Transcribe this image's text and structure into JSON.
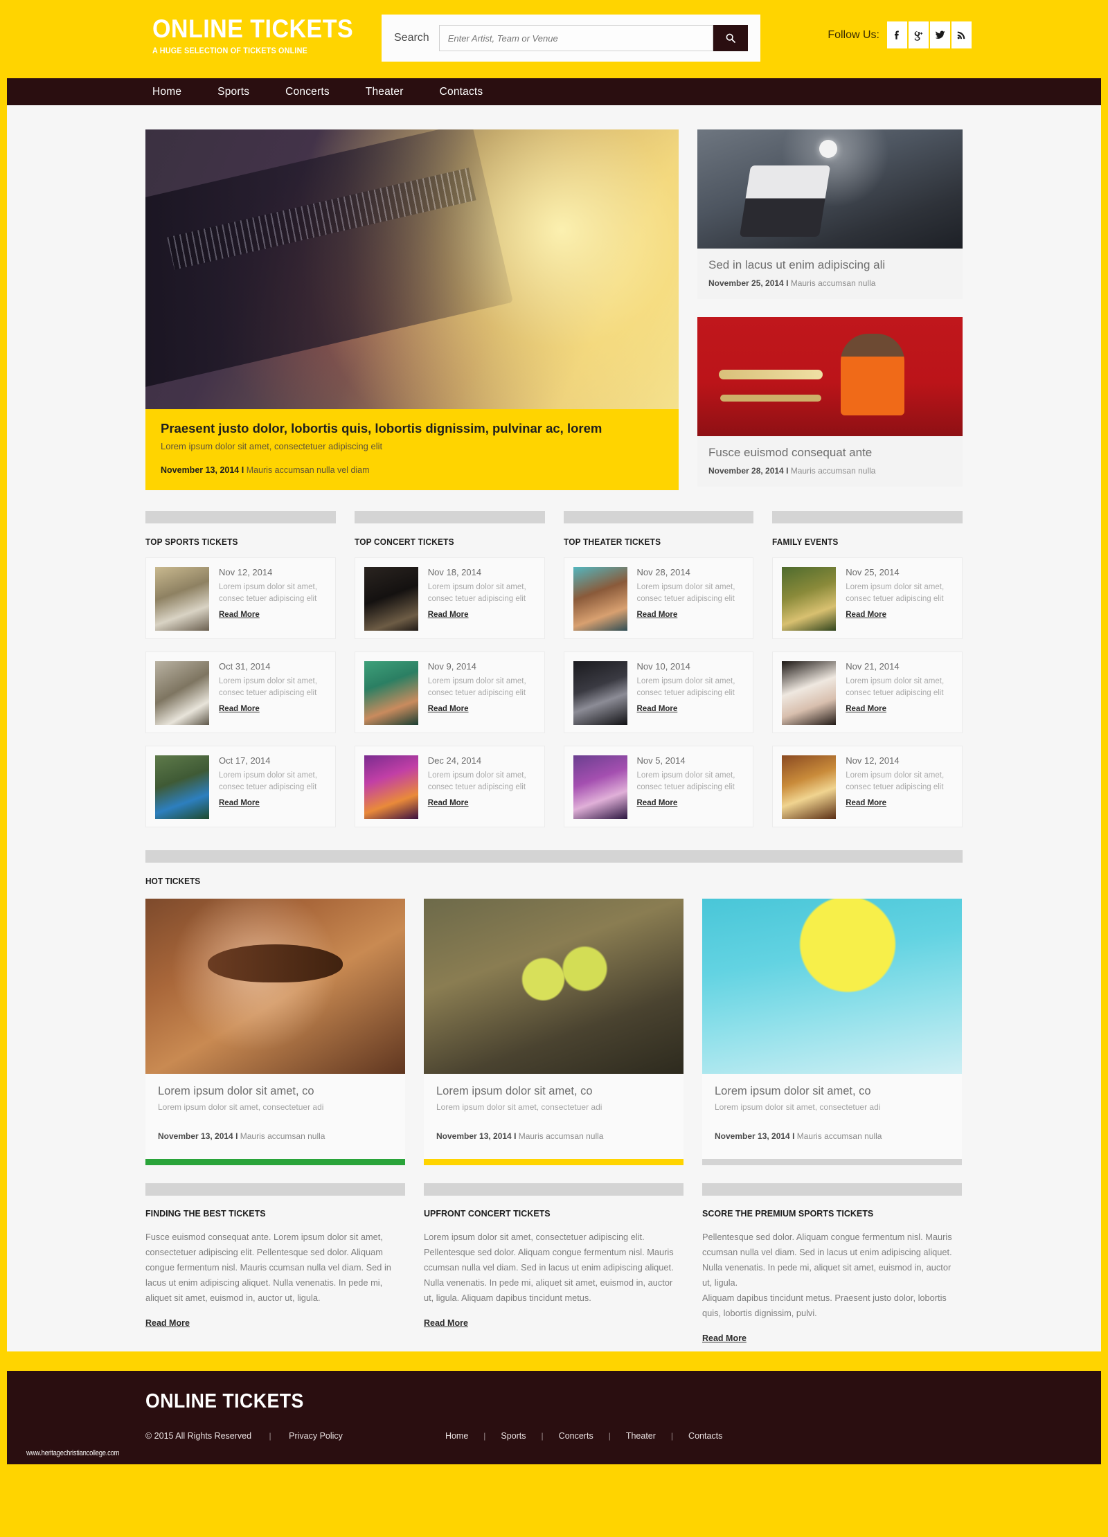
{
  "header": {
    "brand_title": "ONLINE TICKETS",
    "brand_sub": "A HUGE SELECTION OF TICKETS ONLINE",
    "search_label": "Search",
    "search_value": "",
    "search_placeholder": "Enter Artist, Team or Venue",
    "search_icon": "search-icon",
    "follow_label": "Follow Us:",
    "social": [
      {
        "name": "facebook-icon",
        "label": "f"
      },
      {
        "name": "google-plus-icon",
        "label": "g+"
      },
      {
        "name": "twitter-icon",
        "label": "t"
      },
      {
        "name": "rss-icon",
        "label": "rss"
      }
    ]
  },
  "nav": {
    "items": [
      "Home",
      "Sports",
      "Concerts",
      "Theater",
      "Contacts"
    ]
  },
  "hero": {
    "title": "Praesent justo dolor, lobortis quis, lobortis dignissim, pulvinar ac, lorem",
    "desc": "Lorem ipsum dolor sit amet, consectetuer adipiscing elit",
    "date": "November 13, 2014 I",
    "meta": " Mauris accumsan nulla vel diam"
  },
  "side_cards": [
    {
      "title": "Sed in lacus ut enim adipiscing ali",
      "date": "November 25, 2014 I",
      "meta": " Mauris accumsan nulla"
    },
    {
      "title": "Fusce euismod consequat ante",
      "date": "November 28, 2014 I",
      "meta": " Mauris accumsan nulla"
    }
  ],
  "columns": [
    {
      "heading": "TOP SPORTS TICKETS",
      "items": [
        {
          "date": "Nov 12, 2014",
          "desc": "Lorem ipsum dolor sit amet, consec tetuer adipiscing elit",
          "more": "Read More"
        },
        {
          "date": "Oct 31, 2014",
          "desc": "Lorem ipsum dolor sit amet, consec tetuer adipiscing elit",
          "more": "Read More"
        },
        {
          "date": "Oct 17, 2014",
          "desc": "Lorem ipsum dolor sit amet, consec tetuer adipiscing elit",
          "more": "Read More"
        }
      ]
    },
    {
      "heading": "TOP CONCERT TICKETS",
      "items": [
        {
          "date": "Nov 18, 2014",
          "desc": "Lorem ipsum dolor sit amet, consec tetuer adipiscing elit",
          "more": "Read More"
        },
        {
          "date": "Nov 9, 2014",
          "desc": "Lorem ipsum dolor sit amet, consec tetuer adipiscing elit",
          "more": "Read More"
        },
        {
          "date": "Dec 24, 2014",
          "desc": "Lorem ipsum dolor sit amet, consec tetuer adipiscing elit",
          "more": "Read More"
        }
      ]
    },
    {
      "heading": "TOP THEATER TICKETS",
      "items": [
        {
          "date": "Nov 28, 2014",
          "desc": "Lorem ipsum dolor sit amet, consec tetuer adipiscing elit",
          "more": "Read More"
        },
        {
          "date": "Nov 10, 2014",
          "desc": "Lorem ipsum dolor sit amet, consec tetuer adipiscing elit",
          "more": "Read More"
        },
        {
          "date": "Nov 5, 2014",
          "desc": "Lorem ipsum dolor sit amet, consec tetuer adipiscing elit",
          "more": "Read More"
        }
      ]
    },
    {
      "heading": "FAMILY EVENTS",
      "items": [
        {
          "date": "Nov 25, 2014",
          "desc": "Lorem ipsum dolor sit amet, consec tetuer adipiscing elit",
          "more": "Read More"
        },
        {
          "date": "Nov 21, 2014",
          "desc": "Lorem ipsum dolor sit amet, consec tetuer adipiscing elit",
          "more": "Read More"
        },
        {
          "date": "Nov 12, 2014",
          "desc": "Lorem ipsum dolor sit amet, consec tetuer adipiscing elit",
          "more": "Read More"
        }
      ]
    }
  ],
  "hot": {
    "heading": "HOT TICKETS",
    "cards": [
      {
        "title": "Lorem ipsum dolor sit amet, co",
        "desc": "Lorem ipsum dolor sit amet, consectetuer adi",
        "date": "November 13, 2014 I",
        "meta": " Mauris accumsan nulla",
        "rule_color": "#2aa43a"
      },
      {
        "title": "Lorem ipsum dolor sit amet, co",
        "desc": "Lorem ipsum dolor sit amet, consectetuer adi",
        "date": "November 13, 2014 I",
        "meta": " Mauris accumsan nulla",
        "rule_color": "#ffd400"
      },
      {
        "title": "Lorem ipsum dolor sit amet, co",
        "desc": "Lorem ipsum dolor sit amet, consectetuer adi",
        "date": "November 13, 2014 I",
        "meta": " Mauris accumsan nulla",
        "rule_color": "#d4d4d4"
      }
    ]
  },
  "text_columns": [
    {
      "heading": "FINDING THE BEST TICKETS",
      "body": "Fusce euismod consequat ante. Lorem ipsum dolor sit amet, consectetuer adipiscing elit. Pellentesque sed dolor. Aliquam congue fermentum nisl. Mauris ccumsan nulla vel diam. Sed in lacus ut enim adipiscing aliquet. Nulla venenatis. In pede mi, aliquet sit amet, euismod in, auctor ut, ligula.",
      "more": "Read More"
    },
    {
      "heading": "UPFRONT CONCERT TICKETS",
      "body": "Lorem ipsum dolor sit amet, consectetuer adipiscing elit. Pellentesque sed dolor. Aliquam congue fermentum nisl. Mauris ccumsan nulla vel diam. Sed in lacus ut enim adipiscing aliquet. Nulla venenatis. In pede mi, aliquet sit amet, euismod in, auctor ut, ligula. Aliquam dapibus tincidunt metus.",
      "more": "Read More"
    },
    {
      "heading": "SCORE THE PREMIUM SPORTS TICKETS",
      "body": "Pellentesque sed dolor. Aliquam congue fermentum nisl. Mauris ccumsan nulla vel diam. Sed in lacus ut enim adipiscing aliquet. Nulla venenatis. In pede mi, aliquet sit amet, euismod in, auctor ut, ligula.\nAliquam dapibus tincidunt metus. Praesent justo dolor, lobortis quis, lobortis dignissim, pulvi.",
      "more": "Read More"
    }
  ],
  "footer": {
    "brand": "ONLINE TICKETS",
    "copyright": "© 2015 All Rights Reserved",
    "sep": "|",
    "privacy": "Privacy Policy",
    "nav": [
      "Home",
      "Sports",
      "Concerts",
      "Theater",
      "Contacts"
    ],
    "watermark": "www.heritagechristiancollege.com"
  },
  "colors": {
    "brand_yellow": "#ffd400",
    "dark": "#2a0e10",
    "canvas": "#f6f6f6"
  }
}
